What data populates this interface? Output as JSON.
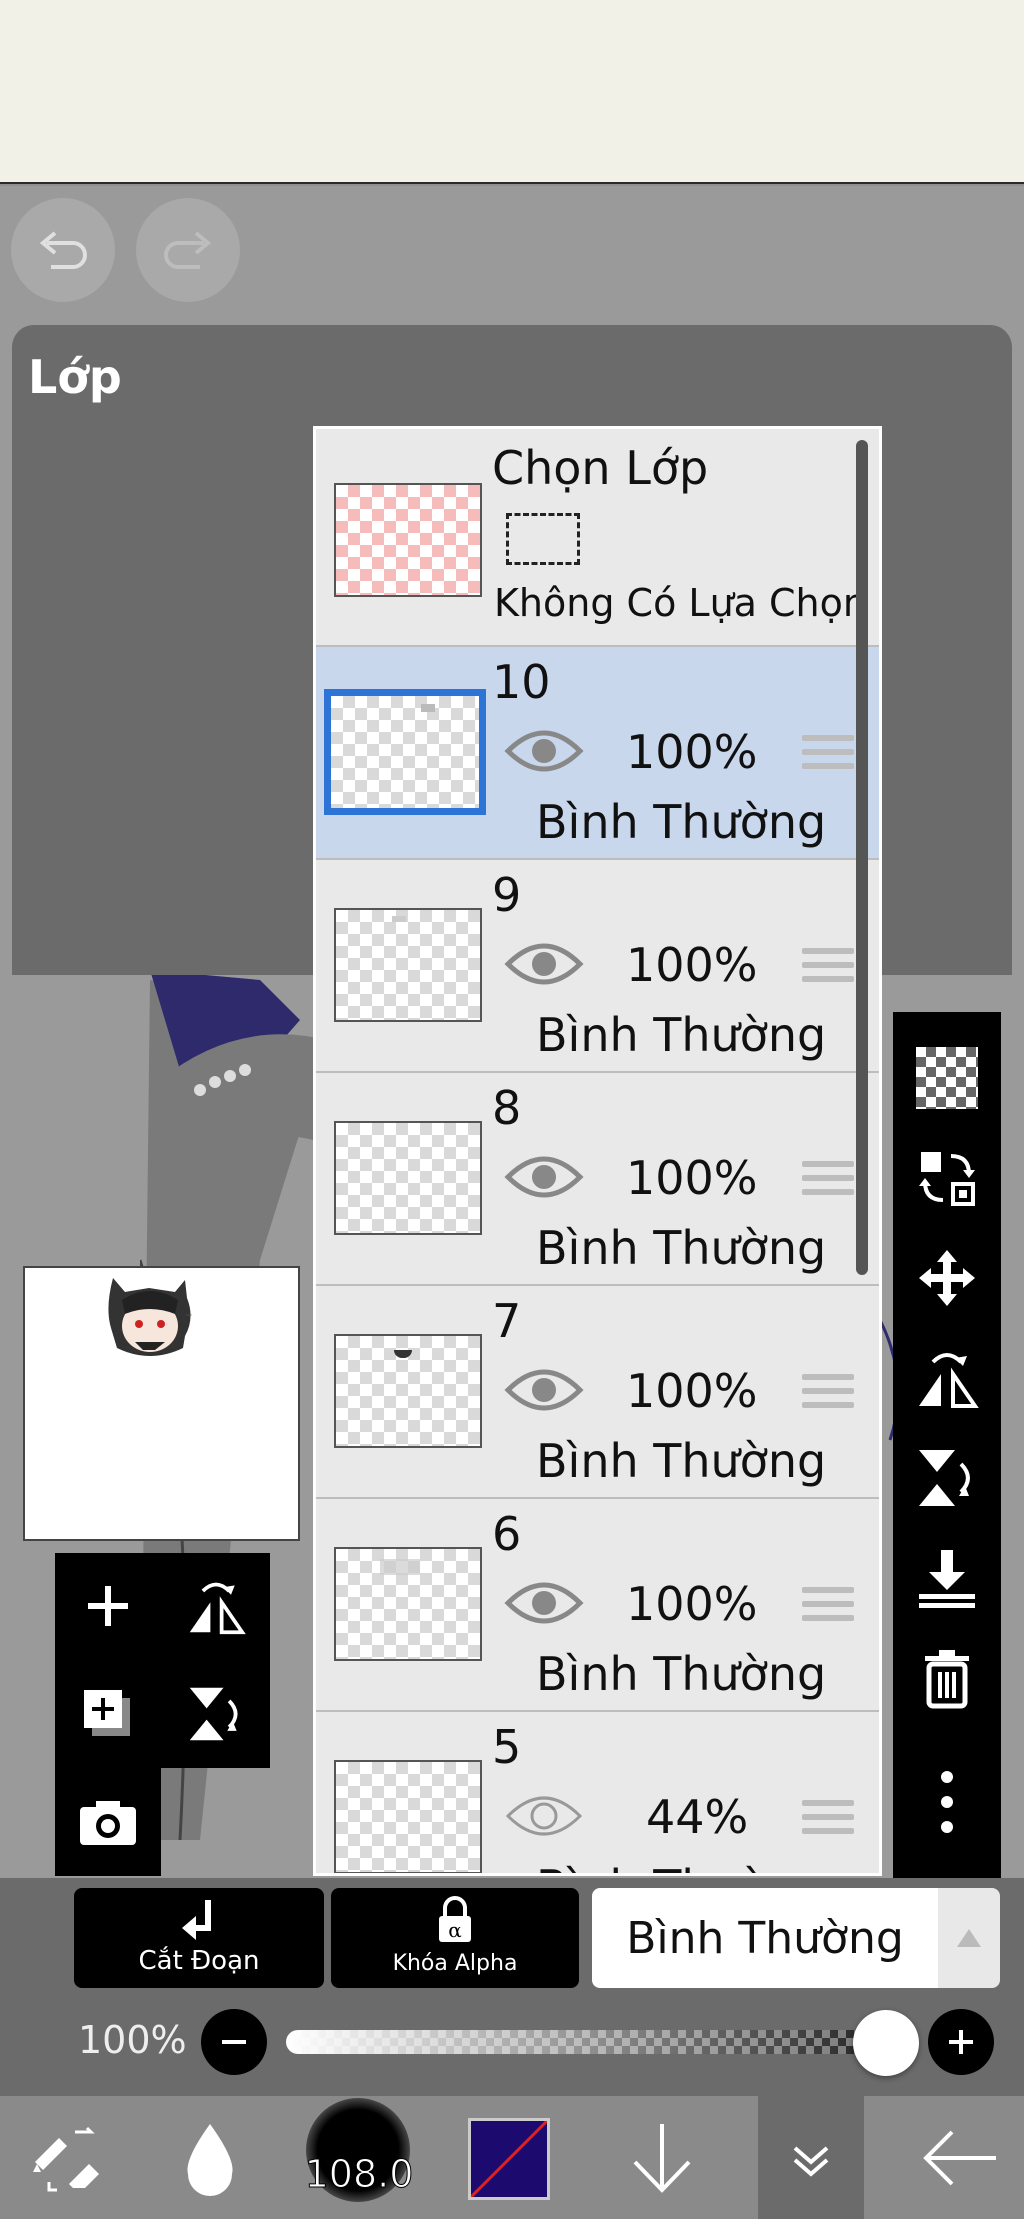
{
  "app": {
    "panel_title": "Lớp",
    "undo_icon": "undo-icon",
    "redo_icon": "redo-icon"
  },
  "layers": {
    "selection_row": {
      "title": "Chọn Lớp",
      "status": "Không Có Lựa Chọn"
    },
    "items": [
      {
        "number": "10",
        "opacity": "100%",
        "blend": "Bình Thường",
        "selected": true
      },
      {
        "number": "9",
        "opacity": "100%",
        "blend": "Bình Thường",
        "selected": false
      },
      {
        "number": "8",
        "opacity": "100%",
        "blend": "Bình Thường",
        "selected": false
      },
      {
        "number": "7",
        "opacity": "100%",
        "blend": "Bình Thường",
        "selected": false
      },
      {
        "number": "6",
        "opacity": "100%",
        "blend": "Bình Thường",
        "selected": false
      },
      {
        "number": "5",
        "opacity": "44%",
        "blend": "Bình Thường",
        "selected": false
      }
    ]
  },
  "controls": {
    "clipping_label": "Cắt Đoạn",
    "alpha_lock_label": "Khóa Alpha",
    "blend_mode_value": "Bình Thường",
    "opacity_label": "100%",
    "opacity_value": 1.0
  },
  "toolbar": {
    "brush_size": "108.0",
    "color": "#1d0a6e"
  },
  "colors": {
    "selected_row": "#c9d7ec",
    "selected_border": "#2e73d6",
    "panel_bg": "#6b6b6b"
  }
}
